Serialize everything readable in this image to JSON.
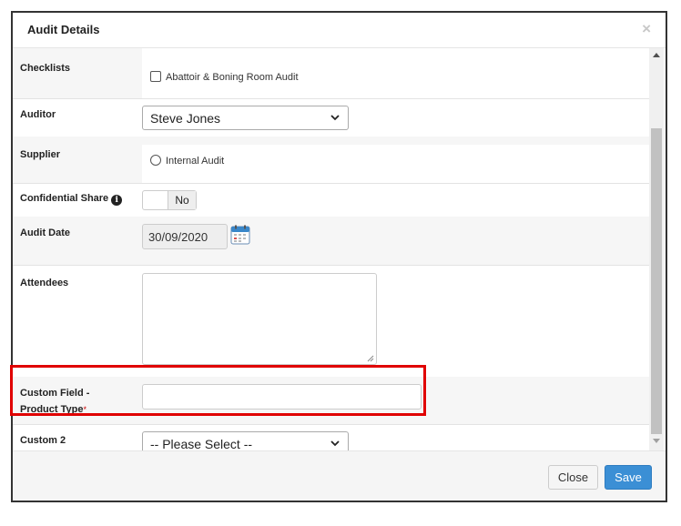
{
  "dialog": {
    "title": "Audit Details",
    "close_glyph": "×"
  },
  "fields": {
    "checklists": {
      "label": "Checklists",
      "option": "Abattoir & Boning Room Audit",
      "checked": false
    },
    "auditor": {
      "label": "Auditor",
      "value": "Steve Jones"
    },
    "supplier": {
      "label": "Supplier",
      "option": "Internal Audit",
      "selected": false
    },
    "confidential_share": {
      "label": "Confidential Share",
      "info_glyph": "i",
      "toggle_value": "No"
    },
    "audit_date": {
      "label": "Audit Date",
      "value": "30/09/2020"
    },
    "attendees": {
      "label": "Attendees",
      "value": ""
    },
    "custom_field": {
      "label_line1": "Custom Field -",
      "label_line2": "Product Type",
      "required_mark": "*",
      "value": ""
    },
    "custom2": {
      "label": "Custom 2",
      "value": "-- Please Select --"
    }
  },
  "footer": {
    "close_label": "Close",
    "save_label": "Save"
  },
  "colors": {
    "save_button": "#3b8fd5",
    "highlight": "#e00000",
    "row_alt": "#f6f6f6"
  },
  "icons": [
    "close-icon",
    "chevron-down-icon",
    "info-icon",
    "calendar-icon",
    "resize-handle-icon",
    "scroll-up-icon",
    "scroll-down-icon"
  ]
}
